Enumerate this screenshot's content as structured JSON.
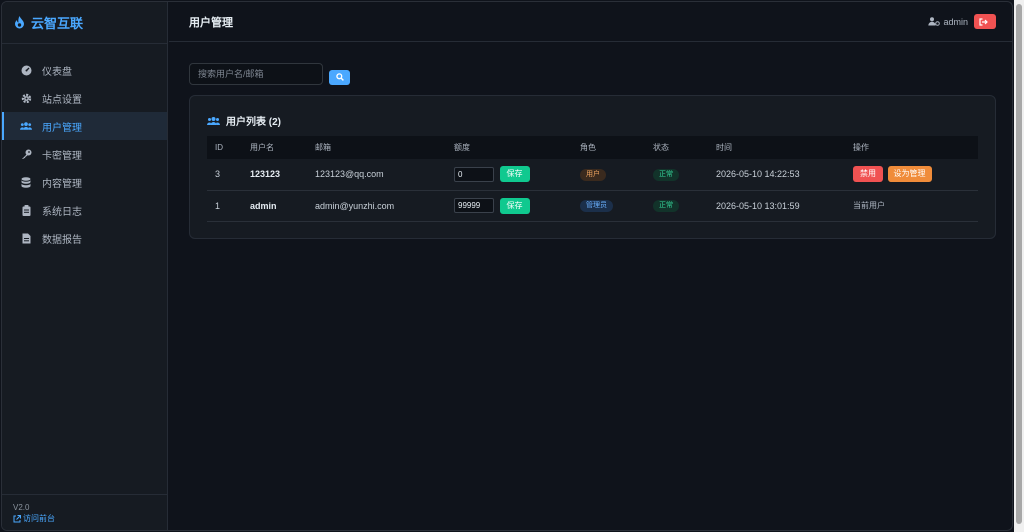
{
  "brand": {
    "name": "云智互联",
    "accent": "#4aa8ff"
  },
  "sidebar": {
    "items": [
      {
        "label": "仪表盘",
        "icon": "dashboard-icon"
      },
      {
        "label": "站点设置",
        "icon": "gear-icon"
      },
      {
        "label": "用户管理",
        "icon": "users-icon",
        "active": true
      },
      {
        "label": "卡密管理",
        "icon": "key-icon"
      },
      {
        "label": "内容管理",
        "icon": "database-icon"
      },
      {
        "label": "系统日志",
        "icon": "clipboard-icon"
      },
      {
        "label": "数据报告",
        "icon": "file-icon"
      }
    ],
    "version": "V2.0",
    "visit_front": "访问前台"
  },
  "header": {
    "title": "用户管理",
    "username": "admin"
  },
  "search": {
    "placeholder": "搜索用户名/邮箱",
    "value": ""
  },
  "card": {
    "title": "用户列表 (2)"
  },
  "table": {
    "columns": [
      "ID",
      "用户名",
      "邮箱",
      "额度",
      "角色",
      "状态",
      "时间",
      "操作"
    ],
    "rows": [
      {
        "id": "3",
        "username": "123123",
        "email": "123123@qq.com",
        "quota": "0",
        "save": "保存",
        "role": "用户",
        "status": "正常",
        "time": "2026-05-10 14:22:53",
        "action_disable": "禁用",
        "action_make_admin": "设为管理"
      },
      {
        "id": "1",
        "username": "admin",
        "email": "admin@yunzhi.com",
        "quota": "99999",
        "save": "保存",
        "role": "管理员",
        "status": "正常",
        "time": "2026-05-10 13:01:59",
        "current_user": "当前用户"
      }
    ]
  },
  "colors": {
    "background": "#0f131b",
    "panel": "#161b22",
    "accent": "#4aa8ff",
    "success": "#10c98f",
    "danger": "#f05252",
    "warning": "#f08c3a"
  }
}
